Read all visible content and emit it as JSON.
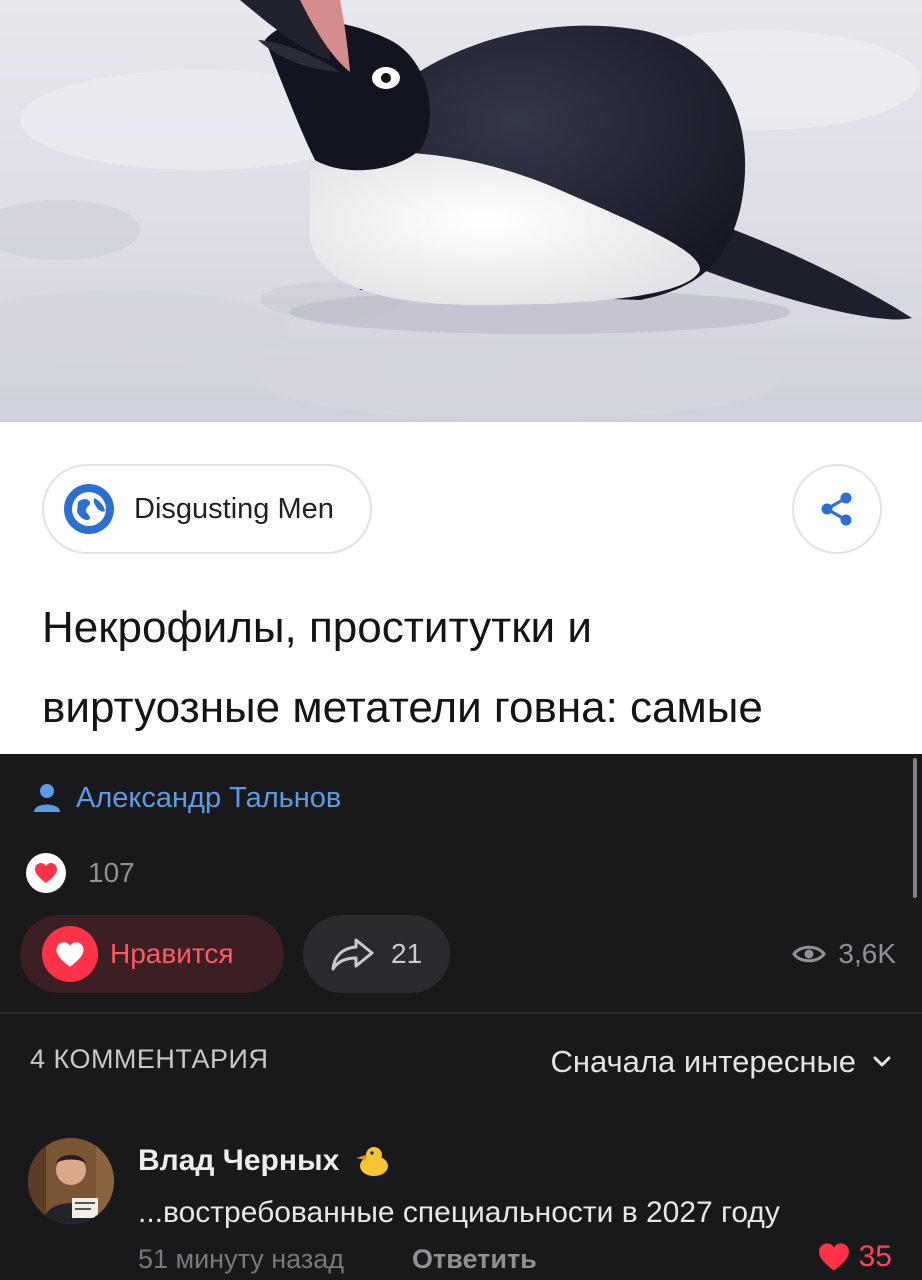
{
  "source": {
    "name": "Disgusting Men",
    "icon": "globe-icon"
  },
  "article": {
    "headline_line1": "Некрофилы, проститутки и",
    "headline_line2": "виртуозные метатели говна: самые"
  },
  "author": {
    "name": "Александр Тальнов",
    "icon": "person-icon"
  },
  "reactions": {
    "likes": "107"
  },
  "actions": {
    "like_label": "Нравится",
    "reposts": "21",
    "views": "3,6K"
  },
  "comments": {
    "count_label": "4 КОММЕНТАРИЯ",
    "sort_label": "Сначала интересные",
    "items": [
      {
        "author": "Влад Черных",
        "text": "...востребованные специальности в 2027 году",
        "time": "51 минуту назад",
        "reply_label": "Ответить",
        "likes": "35"
      }
    ]
  },
  "colors": {
    "accent_link": "#5c9ce6",
    "like_red": "#ff3347",
    "dark_bg": "#19191b"
  }
}
